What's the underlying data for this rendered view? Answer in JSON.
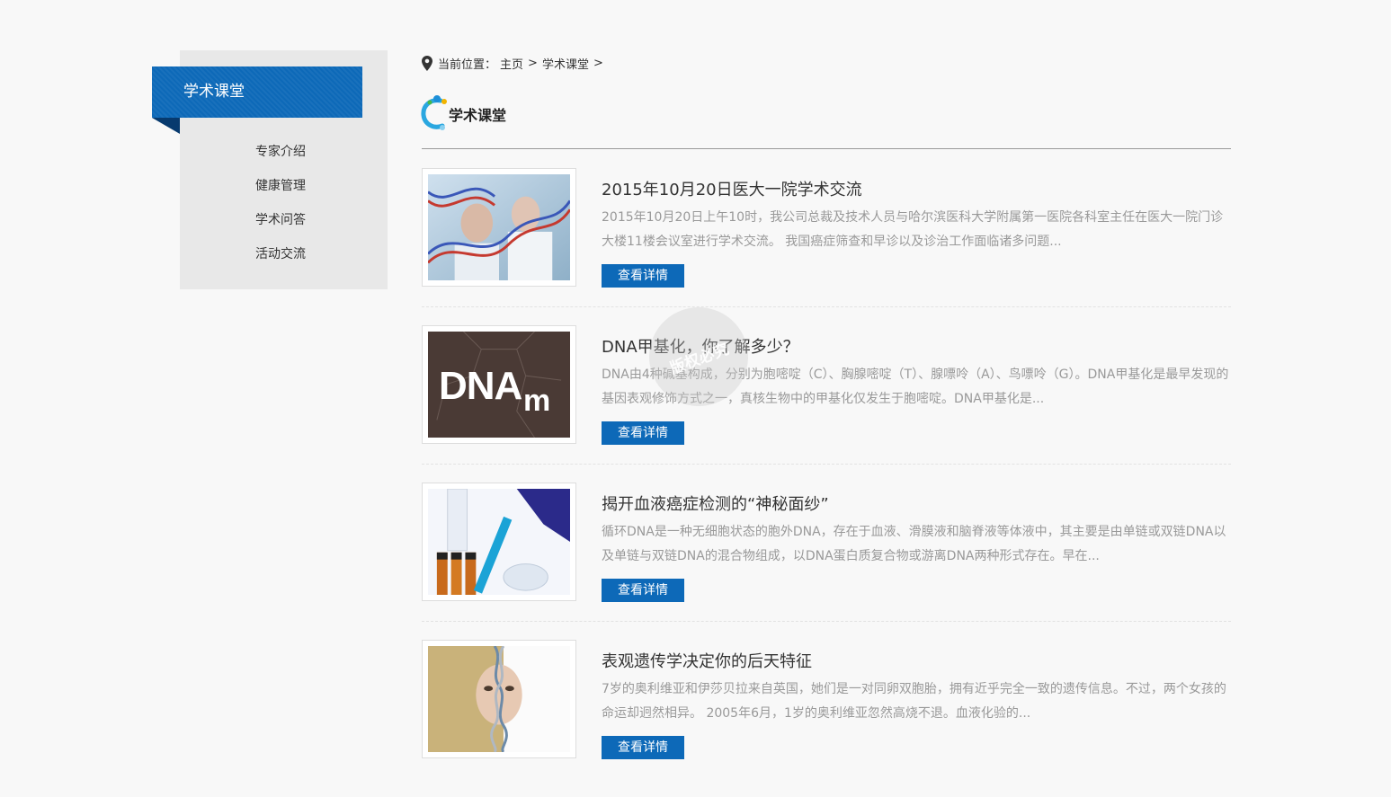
{
  "sidebar": {
    "title": "学术课堂",
    "items": [
      {
        "label": "专家介绍"
      },
      {
        "label": "健康管理"
      },
      {
        "label": "学术问答"
      },
      {
        "label": "活动交流"
      }
    ]
  },
  "breadcrumb": {
    "prefix": "当前位置：",
    "home": "主页",
    "current": "学术课堂",
    "separator": ">"
  },
  "section": {
    "title": "学术课堂"
  },
  "articles": [
    {
      "title": "2015年10月20日医大一院学术交流",
      "summary": "2015年10月20日上午10时，我公司总裁及技术人员与哈尔滨医科大学附属第一医院各科室主任在医大一院门诊大楼11楼会议室进行学术交流。 我国癌症筛查和早诊以及诊治工作面临诸多问题...",
      "button": "查看详情"
    },
    {
      "title": "DNA甲基化，你了解多少？",
      "summary": "DNA由4种碱基构成，分别为胞嘧啶（C）、胸腺嘧啶（T）、腺嘌呤（A）、鸟嘌呤（G）。DNA甲基化是最早发现的基因表观修饰方式之一，真核生物中的甲基化仅发生于胞嘧啶。DNA甲基化是...",
      "button": "查看详情",
      "image_text": "DNA",
      "image_subscript": "m"
    },
    {
      "title": "揭开血液癌症检测的“神秘面纱”",
      "summary": "循环DNA是一种无细胞状态的胞外DNA，存在于血液、滑膜液和脑脊液等体液中，其主要是由单链或双链DNA以及单链与双链DNA的混合物组成，以DNA蛋白质复合物或游离DNA两种形式存在。早在...",
      "button": "查看详情"
    },
    {
      "title": "表观遗传学决定你的后天特征",
      "summary": "7岁的奥利维亚和伊莎贝拉来自英国，她们是一对同卵双胞胎，拥有近乎完全一致的遗传信息。不过，两个女孩的命运却迥然相异。 2005年6月，1岁的奥利维亚忽然高烧不退。血液化验的...",
      "button": "查看详情"
    }
  ],
  "watermark": {
    "text": "版权必究"
  },
  "colors": {
    "accent": "#0d69b8",
    "sidebar_bg": "#e8e8e8",
    "page_bg": "#f8f8f8"
  }
}
